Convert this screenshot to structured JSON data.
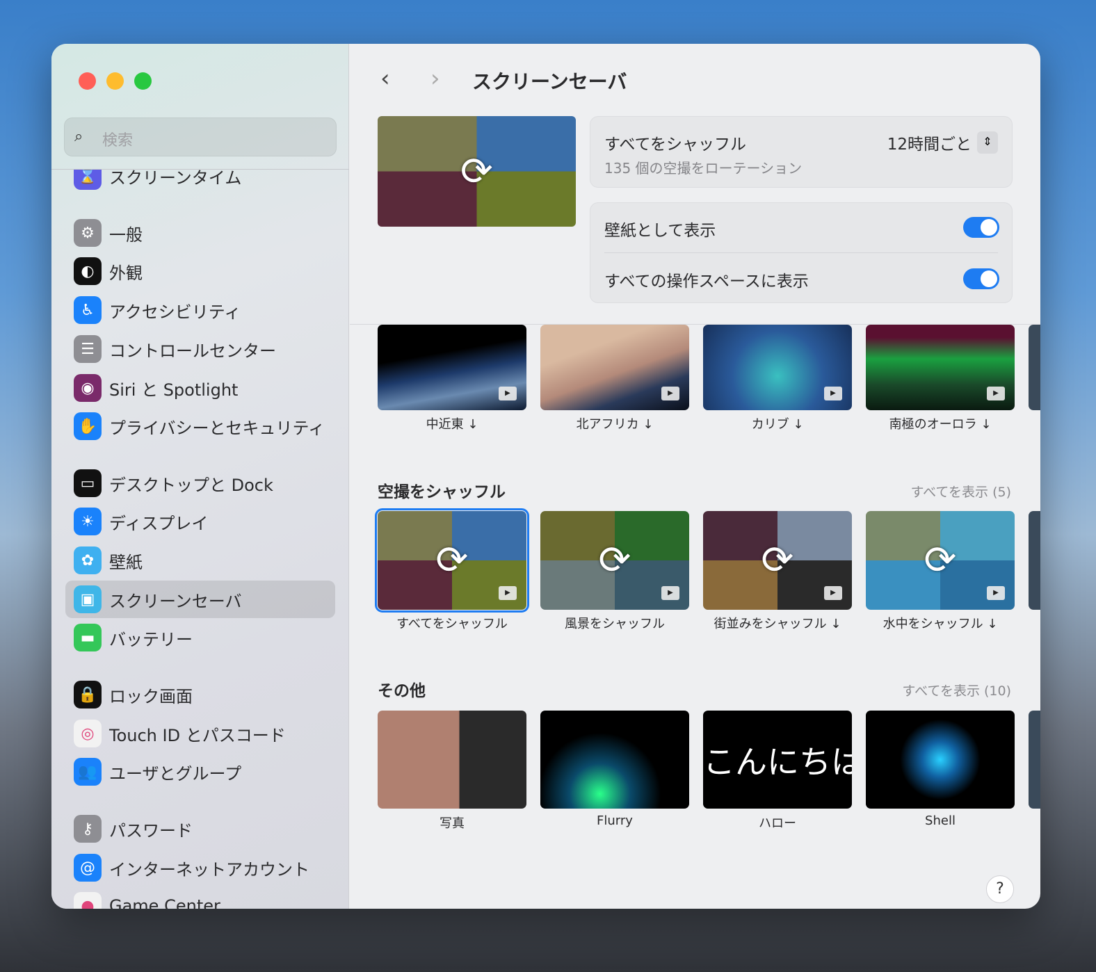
{
  "window": {
    "controls": {
      "close_color": "#ff5f57",
      "minimize_color": "#febc2e",
      "zoom_color": "#28c840"
    }
  },
  "sidebar": {
    "search_placeholder": "検索",
    "selected": "スクリーンセーバ",
    "items": [
      {
        "label": "スクリーンタイム",
        "icon": "hourglass-icon",
        "color": "#5e5ce6"
      },
      {
        "label": "一般",
        "icon": "gear-icon",
        "color": "#8e8e93"
      },
      {
        "label": "外観",
        "icon": "appearance-icon",
        "color": "#111111"
      },
      {
        "label": "アクセシビリティ",
        "icon": "accessibility-icon",
        "color": "#1a82fb"
      },
      {
        "label": "コントロールセンター",
        "icon": "toggles-icon",
        "color": "#8e8e93"
      },
      {
        "label": "Siri と Spotlight",
        "icon": "siri-icon",
        "color": "#7a2a6a"
      },
      {
        "label": "プライバシーとセキュリティ",
        "icon": "hand-icon",
        "color": "#1a82fb"
      },
      {
        "label": "デスクトップと Dock",
        "icon": "dock-icon",
        "color": "#111111"
      },
      {
        "label": "ディスプレイ",
        "icon": "brightness-icon",
        "color": "#1a82fb"
      },
      {
        "label": "壁紙",
        "icon": "flower-icon",
        "color": "#3fb0f0"
      },
      {
        "label": "スクリーンセーバ",
        "icon": "screensaver-icon",
        "color": "#3fb6e8"
      },
      {
        "label": "バッテリー",
        "icon": "battery-icon",
        "color": "#34c759"
      },
      {
        "label": "ロック画面",
        "icon": "lock-icon",
        "color": "#111111"
      },
      {
        "label": "Touch ID とパスコード",
        "icon": "fingerprint-icon",
        "color": "#f2f2f2"
      },
      {
        "label": "ユーザとグループ",
        "icon": "users-icon",
        "color": "#1a82fb"
      },
      {
        "label": "パスワード",
        "icon": "key-icon",
        "color": "#8e8e93"
      },
      {
        "label": "インターネットアカウント",
        "icon": "at-icon",
        "color": "#1a82fb"
      },
      {
        "label": "Game Center",
        "icon": "game-center-icon",
        "color": "#f2f2f2"
      }
    ]
  },
  "header": {
    "title": "スクリーンセーバ",
    "back": "‹",
    "forward": "›"
  },
  "settings": {
    "shuffle_title": "すべてをシャッフル",
    "shuffle_sub": "135 個の空撮をローテーション",
    "interval": "12時間ごと",
    "wallpaper_label": "壁紙として表示",
    "wallpaper_on": true,
    "spaces_label": "すべての操作スペースに表示",
    "spaces_on": true
  },
  "aerials": [
    {
      "label": "中近東 ↓"
    },
    {
      "label": "北アフリカ ↓"
    },
    {
      "label": "カリブ ↓"
    },
    {
      "label": "南極のオーロラ ↓"
    }
  ],
  "shuffle_section": {
    "title": "空撮をシャッフル",
    "show_all": "すべてを表示 (5)",
    "items": [
      {
        "label": "すべてをシャッフル"
      },
      {
        "label": "風景をシャッフル"
      },
      {
        "label": "街並みをシャッフル ↓"
      },
      {
        "label": "水中をシャッフル ↓"
      }
    ]
  },
  "other_section": {
    "title": "その他",
    "show_all": "すべてを表示 (10)",
    "items": [
      {
        "label": "写真"
      },
      {
        "label": "Flurry"
      },
      {
        "label": "ハロー",
        "art_text": "こんにちは"
      },
      {
        "label": "Shell"
      }
    ]
  },
  "accent": "#1e7cf2"
}
